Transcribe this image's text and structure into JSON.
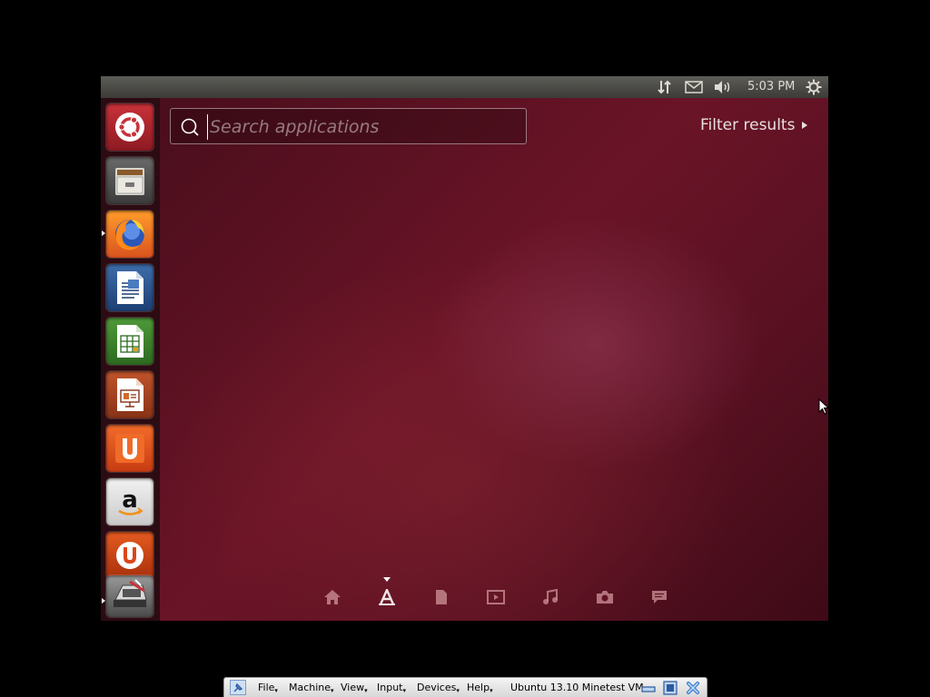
{
  "panel": {
    "clock": "5:03 PM",
    "indicators": [
      "network-icon",
      "mail-icon",
      "volume-icon",
      "session-gear-icon"
    ]
  },
  "launcher": {
    "items": [
      {
        "name": "dash-home",
        "icon": "ubuntu-logo-icon"
      },
      {
        "name": "files",
        "icon": "file-cabinet-icon"
      },
      {
        "name": "firefox",
        "icon": "firefox-icon",
        "running": true
      },
      {
        "name": "libreoffice-writer",
        "icon": "writer-icon"
      },
      {
        "name": "libreoffice-calc",
        "icon": "calc-icon"
      },
      {
        "name": "libreoffice-impress",
        "icon": "impress-icon"
      },
      {
        "name": "ubuntu-software-center",
        "icon": "software-center-icon"
      },
      {
        "name": "amazon",
        "icon": "amazon-icon"
      },
      {
        "name": "ubuntu-one",
        "icon": "ubuntu-one-icon"
      },
      {
        "name": "system-settings",
        "icon": "settings-icon",
        "running": true
      }
    ]
  },
  "dash": {
    "search_placeholder": "Search applications",
    "search_value": "",
    "filter_label": "Filter results",
    "lenses": [
      "home-icon",
      "applications-icon",
      "files-icon",
      "video-icon",
      "music-icon",
      "photos-icon",
      "social-icon"
    ],
    "active_lens": "applications-icon"
  },
  "vbox": {
    "menus": [
      "File",
      "Machine",
      "View",
      "Input",
      "Devices",
      "Help"
    ],
    "vm_title": "Ubuntu 13.10 Minetest VM"
  },
  "colors": {
    "dash_background": "#5e1224",
    "launcher_background": "#2d0c12",
    "panel_background": "#3c3b37",
    "vbox_bar": "#e6e6e6"
  }
}
